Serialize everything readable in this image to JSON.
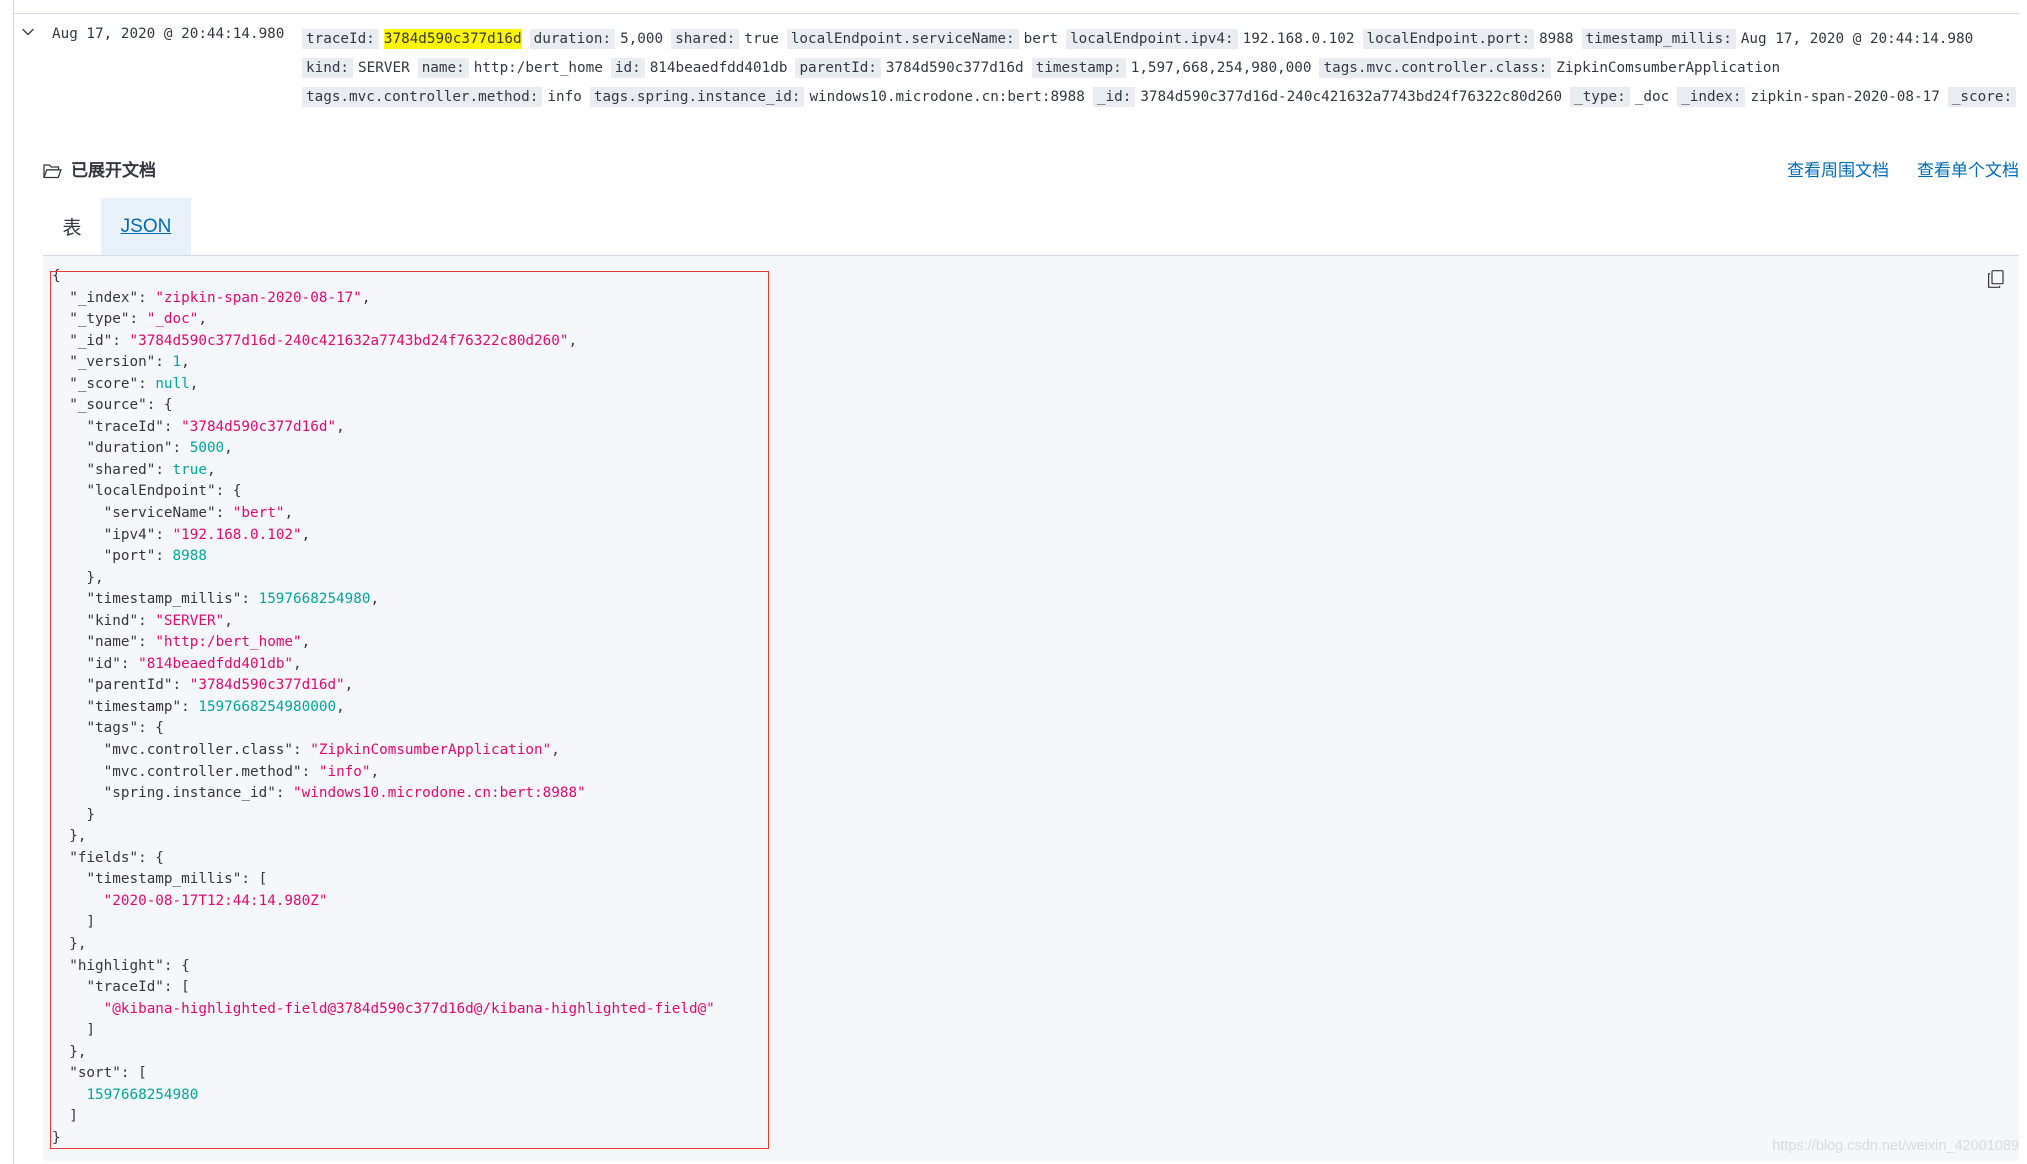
{
  "colors": {
    "link": "#006BB4",
    "json_string": "#DD0A73",
    "json_number": "#00A69B",
    "search_highlight": "#FFF700",
    "annotation": "#E53935",
    "text": "#343741"
  },
  "document_row": {
    "toggle_icon": "chevron-down-icon",
    "timestamp": "Aug 17, 2020 @ 20:44:14.980",
    "summary_rows": [
      [
        {
          "key": "traceId:",
          "value": "3784d590c377d16d",
          "highlighted": true
        },
        {
          "key": "duration:",
          "value": "5,000"
        },
        {
          "key": "shared:",
          "value": "true"
        },
        {
          "key": "localEndpoint.serviceName:",
          "value": "bert"
        },
        {
          "key": "localEndpoint.ipv4:",
          "value": "192.168.0.102"
        },
        {
          "key": "localEndpoint.port:",
          "value": "8988"
        },
        {
          "key": "timestamp_millis:",
          "value": "Aug 17, 2020 @ 20:44:14.980"
        }
      ],
      [
        {
          "key": "kind:",
          "value": "SERVER"
        },
        {
          "key": "name:",
          "value": "http:/bert_home"
        },
        {
          "key": "id:",
          "value": "814beaedfdd401db"
        },
        {
          "key": "parentId:",
          "value": "3784d590c377d16d"
        },
        {
          "key": "timestamp:",
          "value": "1,597,668,254,980,000"
        },
        {
          "key": "tags.mvc.controller.class:",
          "value": "ZipkinComsumberApplication"
        }
      ],
      [
        {
          "key": "tags.mvc.controller.method:",
          "value": "info"
        },
        {
          "key": "tags.spring.instance_id:",
          "value": "windows10.microdone.cn:bert:8988"
        },
        {
          "key": "_id:",
          "value": "3784d590c377d16d-240c421632a7743bd24f76322c80d260"
        },
        {
          "key": "_type:",
          "value": "_doc"
        },
        {
          "key": "_index:",
          "value": "zipkin-span-2020-08-17"
        },
        {
          "key": "_score:"
        }
      ]
    ]
  },
  "expanded_doc": {
    "title_icon": "folder-icon",
    "title": "已展开文档",
    "links": [
      "查看周围文档",
      "查看单个文档"
    ],
    "tabs": [
      {
        "label": "表",
        "selected": false
      },
      {
        "label": "JSON",
        "selected": true
      }
    ],
    "copy_icon": "copy-icon",
    "code_lines": [
      "{",
      "  \"_index\": \"zipkin-span-2020-08-17\",",
      "  \"_type\": \"_doc\",",
      "  \"_id\": \"3784d590c377d16d-240c421632a7743bd24f76322c80d260\",",
      "  \"_version\": 1,",
      "  \"_score\": null,",
      "  \"_source\": {",
      "    \"traceId\": \"3784d590c377d16d\",",
      "    \"duration\": 5000,",
      "    \"shared\": true,",
      "    \"localEndpoint\": {",
      "      \"serviceName\": \"bert\",",
      "      \"ipv4\": \"192.168.0.102\",",
      "      \"port\": 8988",
      "    },",
      "    \"timestamp_millis\": 1597668254980,",
      "    \"kind\": \"SERVER\",",
      "    \"name\": \"http:/bert_home\",",
      "    \"id\": \"814beaedfdd401db\",",
      "    \"parentId\": \"3784d590c377d16d\",",
      "    \"timestamp\": 1597668254980000,",
      "    \"tags\": {",
      "      \"mvc.controller.class\": \"ZipkinComsumberApplication\",",
      "      \"mvc.controller.method\": \"info\",",
      "      \"spring.instance_id\": \"windows10.microdone.cn:bert:8988\"",
      "    }",
      "  },",
      "  \"fields\": {",
      "    \"timestamp_millis\": [",
      "      \"2020-08-17T12:44:14.980Z\"",
      "    ]",
      "  },",
      "  \"highlight\": {",
      "    \"traceId\": [",
      "      \"@kibana-highlighted-field@3784d590c377d16d@/kibana-highlighted-field@\"",
      "    ]",
      "  },",
      "  \"sort\": [",
      "    1597668254980",
      "  ]",
      "}"
    ]
  },
  "watermark": "https://blog.csdn.net/weixin_42001089"
}
